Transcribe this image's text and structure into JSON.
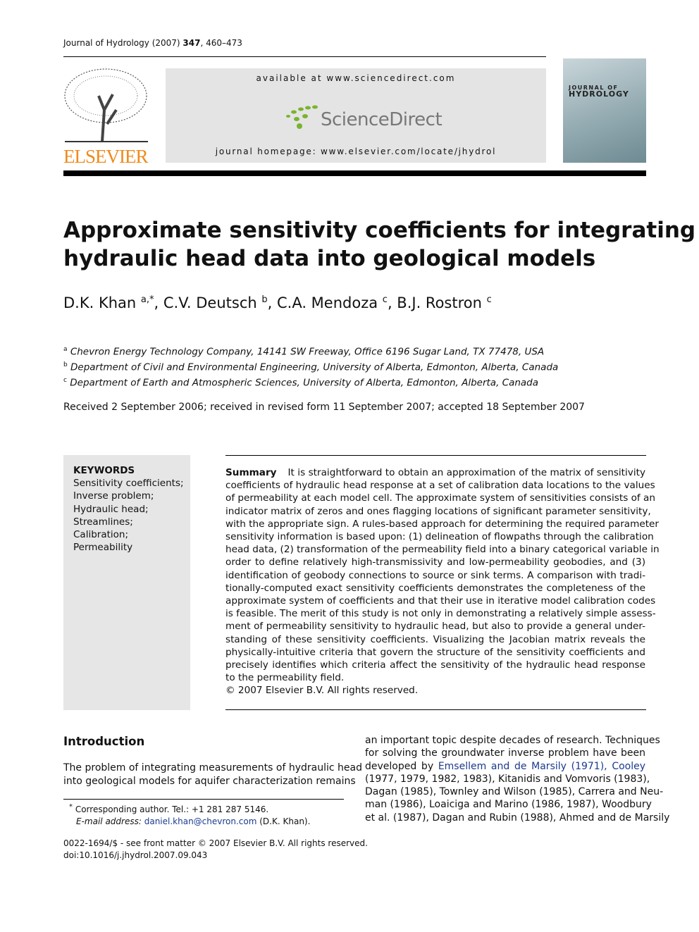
{
  "header": {
    "journal": "Journal of Hydrology",
    "year": "(2007)",
    "volume": "347",
    "pages": ", 460–473"
  },
  "banner": {
    "available": "available at www.sciencedirect.com",
    "sd_logo": "ScienceDirect",
    "homepage": "journal homepage: www.elsevier.com/locate/jhydrol",
    "elsevier_logo": "ELSEVIER",
    "cover_line1": "JOURNAL OF",
    "cover_line2": "HYDROLOGY"
  },
  "title_lines": [
    "Approximate sensitivity coefficients for integrating",
    "hydraulic head data into geological models"
  ],
  "authors": [
    {
      "name": "D.K. Khan",
      "sup": "a,*"
    },
    {
      "name": "C.V. Deutsch",
      "sup": "b"
    },
    {
      "name": "C.A. Mendoza",
      "sup": "c"
    },
    {
      "name": "B.J. Rostron",
      "sup": "c"
    }
  ],
  "affiliations": [
    {
      "sup": "a",
      "text": "Chevron Energy Technology Company, 14141 SW Freeway, Office 6196 Sugar Land, TX 77478, USA"
    },
    {
      "sup": "b",
      "text": "Department of Civil and Environmental Engineering, University of Alberta, Edmonton, Alberta, Canada"
    },
    {
      "sup": "c",
      "text": "Department of Earth and Atmospheric Sciences, University of Alberta, Edmonton, Alberta, Canada"
    }
  ],
  "received": "Received 2 September 2006; received in revised form 11 September 2007; accepted 18 September 2007",
  "keywords": {
    "heading": "KEYWORDS",
    "items": [
      "Sensitivity coefficients;",
      "Inverse problem;",
      "Hydraulic head;",
      "Streamlines;",
      "Calibration;",
      "Permeability"
    ]
  },
  "abstract": {
    "label": "Summary",
    "lines": [
      "It is straightforward to obtain an approximation of the matrix of sensitivity",
      "coefficients of hydraulic head response at a set of calibration data locations to the values",
      "of permeability at each model cell. The approximate system of sensitivities consists of an",
      "indicator matrix of zeros and ones flagging locations of significant parameter sensitivity,",
      "with the appropriate sign. A rules-based approach for determining the required parameter",
      "sensitivity information is based upon: (1) delineation of flowpaths through the calibration",
      "head data, (2) transformation of the permeability field into a binary categorical variable in",
      "order to define relatively high-transmissivity and low-permeability geobodies, and (3)",
      "identification of geobody connections to source or sink terms. A comparison with tradi-",
      "tionally-computed exact sensitivity coefficients demonstrates the completeness of the",
      "approximate system of coefficients and that their use in iterative model calibration codes",
      "is feasible. The merit of this study is not only in demonstrating a relatively simple assess-",
      "ment of permeability sensitivity to hydraulic head, but also to provide a general under-",
      "standing of these sensitivity coefficients. Visualizing the Jacobian matrix reveals the",
      "physically-intuitive criteria that govern the structure of the sensitivity coefficients and",
      "precisely identifies which criteria affect the sensitivity of the hydraulic head response",
      "to the permeability field."
    ],
    "copyright": "© 2007 Elsevier B.V. All rights reserved."
  },
  "intro": {
    "heading": "Introduction",
    "lines": [
      "The problem of integrating measurements of hydraulic head",
      "into geological models for aquifer characterization remains"
    ]
  },
  "right_col": {
    "lines": [
      [
        {
          "t": "an important topic despite decades of research. Techniques"
        }
      ],
      [
        {
          "t": "for solving the groundwater inverse problem have been"
        }
      ],
      [
        {
          "t": "developed by "
        },
        {
          "t": "Emsellem and de Marsily (1971), Cooley",
          "link": true
        }
      ],
      [
        {
          "t": "(1977, 1979, 1982, 1983), Kitanidis and Vomvoris (1983),"
        }
      ],
      [
        {
          "t": "Dagan (1985), Townley and Wilson (1985), Carrera and Neu-"
        }
      ],
      [
        {
          "t": "man (1986), Loaiciga and Marino (1986, 1987), Woodbury"
        }
      ],
      [
        {
          "t": "et al. (1987), Dagan and Rubin (1988), Ahmed and de Marsily"
        }
      ]
    ]
  },
  "footnote": {
    "star": "*",
    "line1": "Corresponding author. Tel.: +1 281 287 5146.",
    "email_label": "E-mail address:",
    "email": "daniel.khan@chevron.com",
    "email_suffix": "(D.K. Khan)."
  },
  "footer": {
    "line1": "0022-1694/$ - see front matter © 2007 Elsevier B.V. All rights reserved.",
    "line2": "doi:10.1016/j.jhydrol.2007.09.043"
  },
  "colors": {
    "elsevier_orange": "#f08a1c",
    "sd_green": "#7ab32e",
    "banner_gray": "#e4e4e4",
    "keywords_bg": "#e6e6e6",
    "link": "#1a3a8f"
  }
}
